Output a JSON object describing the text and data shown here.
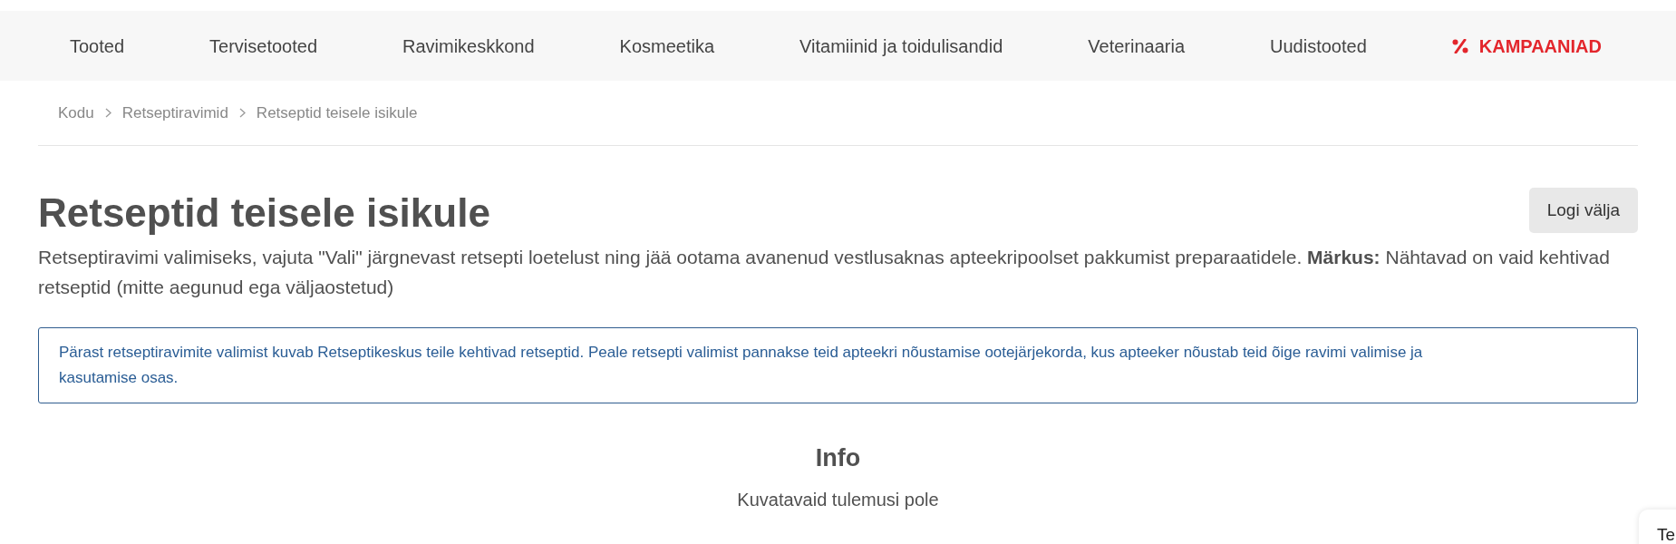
{
  "nav": {
    "items": [
      {
        "label": "Tooted",
        "kind": "link"
      },
      {
        "label": "Tervisetooted",
        "kind": "link"
      },
      {
        "label": "Ravimikeskkond",
        "kind": "link"
      },
      {
        "label": "Kosmeetika",
        "kind": "link"
      },
      {
        "label": "Vitamiinid ja toidulisandid",
        "kind": "link"
      },
      {
        "label": "Veterinaaria",
        "kind": "link"
      },
      {
        "label": "Uudistooted",
        "kind": "link"
      },
      {
        "label": "KAMPAANIAD",
        "kind": "promo"
      }
    ]
  },
  "breadcrumb": [
    "Kodu",
    "Retseptiravimid",
    "Retseptid teisele isikule"
  ],
  "page": {
    "title": "Retseptid teisele isikule",
    "logout_button": "Logi välja",
    "intro": "Retseptiravimi valimiseks, vajuta \"Vali\" järgnevast retsepti loetelust ning jää ootama avanenud vestlusaknas apteekripoolset pakkumist preparaatidele. **Märkus:** Nähtavad on vaid kehtivad retseptid (mitte aegunud ega väljaostetud)",
    "notice": "Pärast retseptiravimite valimist kuvab Retseptikeskus teile kehtivad retseptid. Peale retsepti valimist pannakse teid apteekri nõustamise ootejärjekorda, kus apteeker nõustab teid õige ravimi valimise ja kasutamise osas."
  },
  "info": {
    "title": "Info",
    "message": "Kuvatavaid tulemusi pole"
  },
  "chat_widget": {
    "label": "Te"
  }
}
